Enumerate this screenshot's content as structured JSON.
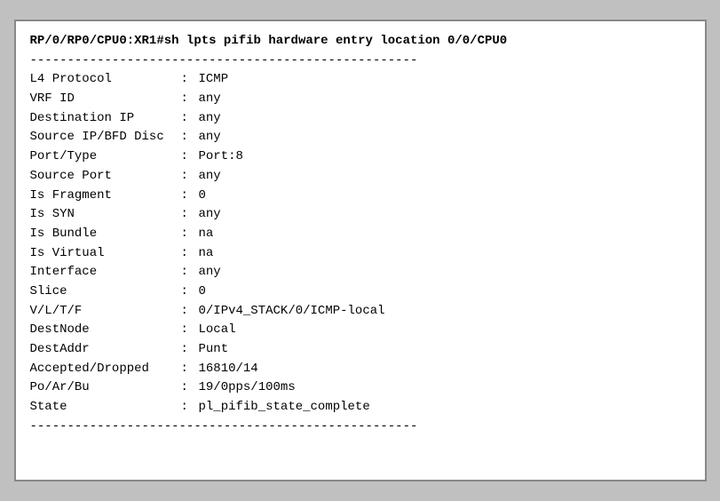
{
  "terminal": {
    "command": "RP/0/RP0/CPU0:XR1#sh lpts pifib hardware entry location 0/0/CPU0",
    "divider": "----------------------------------------------------",
    "entries": [
      {
        "key": "L4 Protocol",
        "sep": ":",
        "value": "ICMP"
      },
      {
        "key": "VRF ID",
        "sep": ":",
        "value": "any"
      },
      {
        "key": "Destination IP",
        "sep": ":",
        "value": "any"
      },
      {
        "key": "Source IP/BFD Disc",
        "sep": ":",
        "value": "any"
      },
      {
        "key": "Port/Type",
        "sep": ":",
        "value": "Port:8"
      },
      {
        "key": "Source Port",
        "sep": ":",
        "value": "any"
      },
      {
        "key": "Is Fragment",
        "sep": ":",
        "value": "0"
      },
      {
        "key": "Is SYN",
        "sep": ":",
        "value": "any"
      },
      {
        "key": "Is Bundle",
        "sep": ":",
        "value": "na"
      },
      {
        "key": "Is Virtual",
        "sep": ":",
        "value": "na"
      },
      {
        "key": "Interface",
        "sep": ":",
        "value": "any"
      },
      {
        "key": "Slice",
        "sep": ":",
        "value": "0"
      },
      {
        "key": "V/L/T/F",
        "sep": ":",
        "value": "0/IPv4_STACK/0/ICMP-local"
      },
      {
        "key": "DestNode",
        "sep": ":",
        "value": "Local"
      },
      {
        "key": "DestAddr",
        "sep": ":",
        "value": "Punt"
      },
      {
        "key": "Accepted/Dropped",
        "sep": ":",
        "value": "16810/14"
      },
      {
        "key": "Po/Ar/Bu",
        "sep": ":",
        "value": "19/0pps/100ms"
      },
      {
        "key": "State",
        "sep": ":",
        "value": "pl_pifib_state_complete"
      }
    ],
    "divider_end": "----------------------------------------------------"
  }
}
